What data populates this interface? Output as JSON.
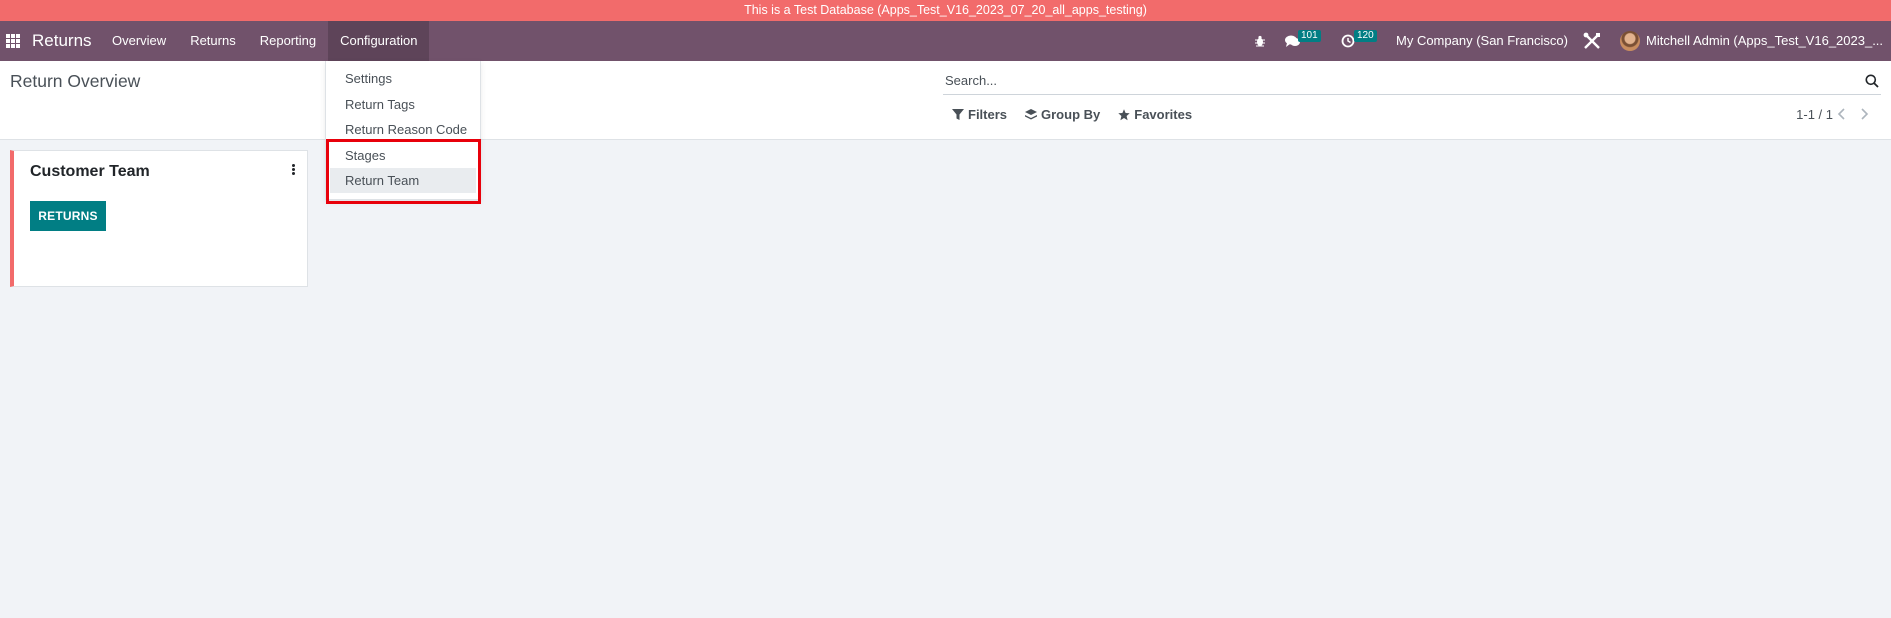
{
  "banner": {
    "text": "This is a Test Database (Apps_Test_V16_2023_07_20_all_apps_testing)"
  },
  "navbar": {
    "app_name": "Returns",
    "menu": [
      {
        "label": "Overview"
      },
      {
        "label": "Returns"
      },
      {
        "label": "Reporting"
      },
      {
        "label": "Configuration"
      }
    ],
    "systray": {
      "messages_count": "101",
      "activities_count": "120",
      "company": "My Company (San Francisco)",
      "user": "Mitchell Admin (Apps_Test_V16_2023_..."
    }
  },
  "control_panel": {
    "title": "Return Overview",
    "search_placeholder": "Search...",
    "filters_label": "Filters",
    "group_by_label": "Group By",
    "favorites_label": "Favorites",
    "pager": "1-1 / 1"
  },
  "config_menu": {
    "items": [
      {
        "label": "Settings"
      },
      {
        "label": "Return Tags"
      },
      {
        "label": "Return Reason Code"
      },
      {
        "label": "Stages"
      },
      {
        "label": "Return Team"
      }
    ]
  },
  "kanban": {
    "cards": [
      {
        "title": "Customer Team",
        "button_label": "RETURNS",
        "color": "#f26b6b"
      }
    ]
  },
  "colors": {
    "navbar": "#71526b",
    "banner": "#f26b6b",
    "primary": "#017e84",
    "highlight": "#e8000b"
  }
}
